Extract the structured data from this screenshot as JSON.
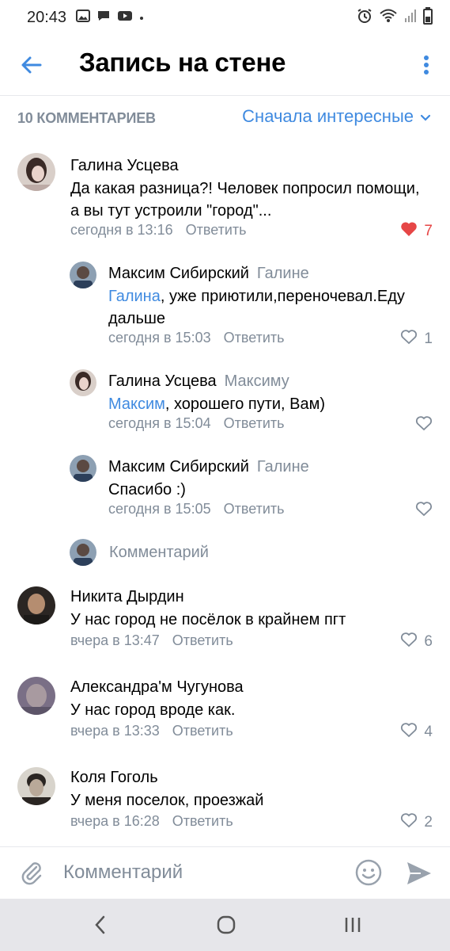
{
  "status_bar": {
    "time": "20:43"
  },
  "header": {
    "title": "Запись на стене"
  },
  "sort_bar": {
    "count": "10 КОММЕНТАРИЕВ",
    "sort": "Сначала интересные"
  },
  "comments": [
    {
      "author": "Галина Усцева",
      "reply_to": "",
      "text_line1": "Да какая разница?! Человек попросил помощи,",
      "text_line2": "а вы тут устроили \"город\"...",
      "time": "сегодня в 13:16",
      "reply_label": "Ответить",
      "likes": "7",
      "liked": true
    },
    {
      "author": "Максим Сибирский",
      "reply_to": "Галине",
      "mention": "Галина",
      "text_rest": ", уже приютили,переночевал.Еду",
      "text_line2": "дальше",
      "time": "сегодня в 15:03",
      "reply_label": "Ответить",
      "likes": "1"
    },
    {
      "author": "Галина Усцева",
      "reply_to": "Максиму",
      "mention": "Максим",
      "text_rest": ", хорошего пути, Вам)",
      "time": "сегодня в 15:04",
      "reply_label": "Ответить",
      "likes": ""
    },
    {
      "author": "Максим Сибирский",
      "reply_to": "Галине",
      "text": "Спасибо :)",
      "time": "сегодня в 15:05",
      "reply_label": "Ответить",
      "likes": ""
    },
    {
      "author": "Никита Дырдин",
      "text": "У нас город не посёлок в крайнем пгт",
      "time": "вчера в 13:47",
      "reply_label": "Ответить",
      "likes": "6"
    },
    {
      "author": "Александра'м Чугунова",
      "text": "У нас город вроде как.",
      "time": "вчера в 13:33",
      "reply_label": "Ответить",
      "likes": "4"
    },
    {
      "author": "Коля Гоголь",
      "text": "У меня поселок, проезжай",
      "time": "вчера в 16:28",
      "reply_label": "Ответить",
      "likes": "2"
    }
  ],
  "thread_reply": {
    "label": "Комментарий"
  },
  "input": {
    "placeholder": "Комментарий"
  },
  "colors": {
    "accent": "#3f8ae0",
    "secondary_text": "#818c99",
    "like_active": "#e64646"
  },
  "icons": [
    "back-arrow-icon",
    "more-vertical-icon",
    "chevron-down-icon",
    "heart-icon",
    "paperclip-icon",
    "smile-icon",
    "send-icon",
    "nav-back-icon",
    "nav-home-icon",
    "nav-recents-icon"
  ]
}
